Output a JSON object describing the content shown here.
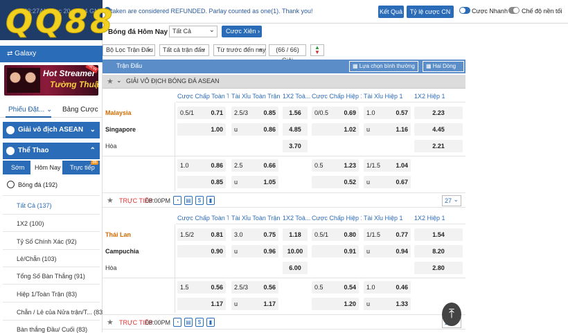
{
  "header": {
    "datetime": "09:03:27AM Dec 20, 2024 GMT +7",
    "ticker": "taken are considered REFUNDED. Parlay counted as one(1). Thank you!",
    "btn_results": "Kết Quả",
    "btn_odds_type": "Tỷ lệ cược CN",
    "toggle_quick": "Cược Nhanh",
    "toggle_bg": "Chế độ nền tối",
    "logo": "QQ88"
  },
  "sidebar": {
    "galaxy": "Galaxy",
    "banner_line1": "Hot Streamer",
    "banner_line2": "Tường Thuật",
    "new_tag": "NEW",
    "tab_slip": "Phiếu Đặt...",
    "tab_bets": "Bảng Cược",
    "section_asean": "Giải vô địch ASEAN",
    "section_sports": "Thể Thao",
    "subtab_early": "Sớm",
    "subtab_today": "Hôm Nay",
    "subtab_live": "Trực tiếp",
    "live_badge": "86",
    "soccer": "Bóng đá",
    "soccer_count": "(192)",
    "items": [
      {
        "label": "Tất Cả",
        "count": "(137)"
      },
      {
        "label": "1X2",
        "count": "(100)"
      },
      {
        "label": "Tỷ Số Chính Xác",
        "count": "(92)"
      },
      {
        "label": "Lẻ/Chẵn",
        "count": "(103)"
      },
      {
        "label": "Tổng Số Bàn Thắng",
        "count": "(91)"
      },
      {
        "label": "Hiệp 1/Toàn Trận",
        "count": "(83)"
      },
      {
        "label": "Chẵn / Lẻ của Nửa trận/T...",
        "count": "(83)"
      },
      {
        "label": "Bàn thắng Đầu/ Cuối",
        "count": "(83)"
      }
    ]
  },
  "filters": {
    "title": "Bóng đá Hôm Nay",
    "market": "Tất Cả",
    "parlay": "Cược Xiên",
    "match_filter": "Bộ Lọc Trận Đấu",
    "all_matches": "Tất cả trận đấu",
    "sort": "Từ trước đến nay",
    "count": "(66 / 66) Giải"
  },
  "table": {
    "head_title": "Trận Đấu",
    "view_select": "Lựa chọn bình thường",
    "lines_select": "Hai Dòng",
    "league": "GIẢI VÔ ĐỊCH BÓNG ĐÁ ASEAN",
    "columns": [
      "Cược Chấp Toàn T...",
      "Tài Xỉu Toàn Trận",
      "1X2 Toà...",
      "Cược Chấp Hiệp 1",
      "Tài Xỉu Hiệp 1",
      "1X2 Hiệp 1"
    ],
    "draw_label": "Hòa",
    "under": "u",
    "live_label": "TRỰC TIẾP",
    "matches": [
      {
        "home": "Malaysia",
        "away": "Singapore",
        "time": "08:00PM",
        "more": "27",
        "main": {
          "hcp": "0.5/1",
          "hcp_h": "0.71",
          "hcp_a": "1.00",
          "ou": "2.5/3",
          "ou_o": "0.85",
          "ou_u": "0.86",
          "x1": "1.56",
          "x2": "4.85",
          "xd": "3.70",
          "h1hcp": "0/0.5",
          "h1hcp_h": "0.69",
          "h1hcp_a": "1.02",
          "h1ou": "1.0",
          "h1ou_o": "0.57",
          "h1ou_u": "1.16",
          "h1x1": "2.23",
          "h1x2": "4.45",
          "h1xd": "2.21"
        },
        "alt": {
          "hcp": "1.0",
          "hcp_h": "0.86",
          "hcp_a": "0.85",
          "ou": "2.5",
          "ou_o": "0.66",
          "ou_u": "1.05",
          "h1hcp": "0.5",
          "h1hcp_h": "1.23",
          "h1hcp_a": "0.52",
          "h1ou": "1/1.5",
          "h1ou_o": "1.04",
          "h1ou_u": "0.67"
        }
      },
      {
        "home": "Thái Lan",
        "away": "Campuchia",
        "time": "08:00PM",
        "more": "27",
        "main": {
          "hcp": "1.5/2",
          "hcp_h": "0.81",
          "hcp_a": "0.90",
          "ou": "3.0",
          "ou_o": "0.75",
          "ou_u": "0.96",
          "x1": "1.18",
          "x2": "10.00",
          "xd": "6.00",
          "h1hcp": "0.5/1",
          "h1hcp_h": "0.80",
          "h1hcp_a": "0.91",
          "h1ou": "1/1.5",
          "h1ou_o": "0.77",
          "h1ou_u": "0.94",
          "h1x1": "1.54",
          "h1x2": "8.20",
          "h1xd": "2.80"
        },
        "alt": {
          "hcp": "1.5",
          "hcp_h": "0.56",
          "hcp_a": "1.17",
          "ou": "2.5/3",
          "ou_o": "0.56",
          "ou_u": "1.17",
          "h1hcp": "0.5",
          "h1hcp_h": "0.54",
          "h1hcp_a": "1.20",
          "h1ou": "1.0",
          "h1ou_o": "0.46",
          "h1ou_u": "1.33"
        }
      }
    ]
  }
}
